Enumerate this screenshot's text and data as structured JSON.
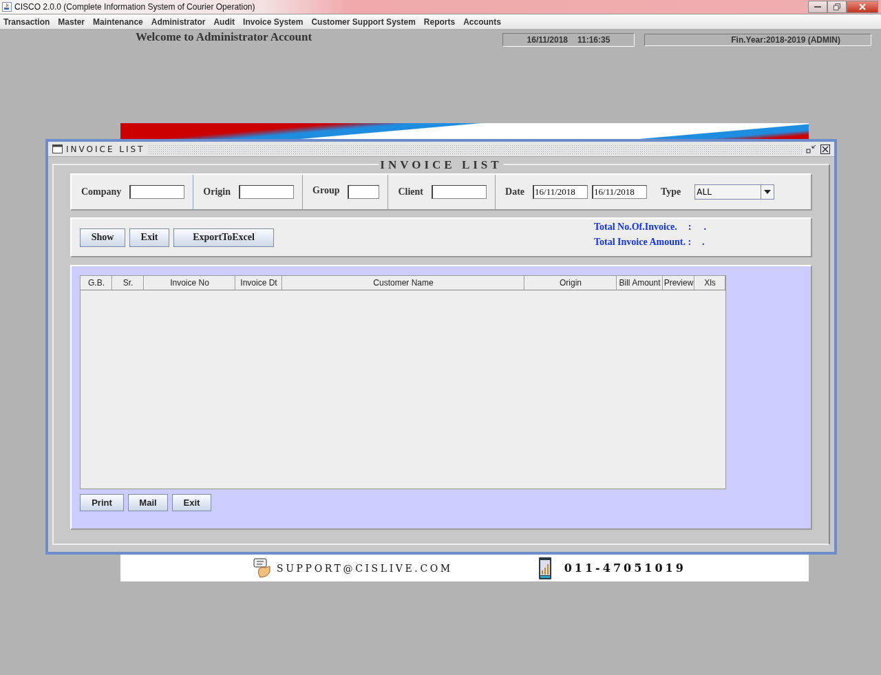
{
  "window": {
    "title": "CISCO 2.0.0 (Complete Information System of Courier Operation)"
  },
  "menu": [
    "Transaction",
    "Master",
    "Maintenance",
    "Administrator",
    "Audit",
    "Invoice System",
    "Customer Support System",
    "Reports",
    "Accounts"
  ],
  "header": {
    "welcome": "Welcome to Administrator Account",
    "date": "16/11/2018",
    "time": "11:16:35",
    "fin_year": "Fin.Year:2018-2019  (ADMIN)"
  },
  "frame": {
    "title": "INVOICE LIST",
    "heading": "INVOICE LIST",
    "filters": [
      {
        "kind": "text",
        "label": "Company"
      },
      {
        "kind": "text",
        "label": "Origin"
      },
      {
        "kind": "short",
        "label": "Group"
      },
      {
        "kind": "text",
        "label": "Client"
      },
      {
        "kind": "range",
        "label": "Date",
        "values": [
          "16/11/2018",
          "16/11/2018"
        ]
      },
      {
        "kind": "select",
        "label": "Type",
        "value": "ALL"
      }
    ],
    "actions": [
      "Show",
      "Exit",
      "ExportToExcel"
    ],
    "totals": [
      {
        "label": "Total No.Of.Invoice.",
        "sep": ":",
        "value": "."
      },
      {
        "label": "Total Invoice Amount. :",
        "value": "."
      }
    ],
    "table": {
      "columns": [
        "G.B.",
        "Sr.",
        "Invoice No",
        "Invoice Dt",
        "Customer Name",
        "Origin",
        "Bill Amount",
        "Preview",
        "Xls"
      ]
    },
    "bottom_buttons": [
      "Print",
      "Mail",
      "Exit"
    ]
  },
  "footer": {
    "email": "SUPPORT@CISLIVE.COM",
    "phone": "011-47051019"
  }
}
